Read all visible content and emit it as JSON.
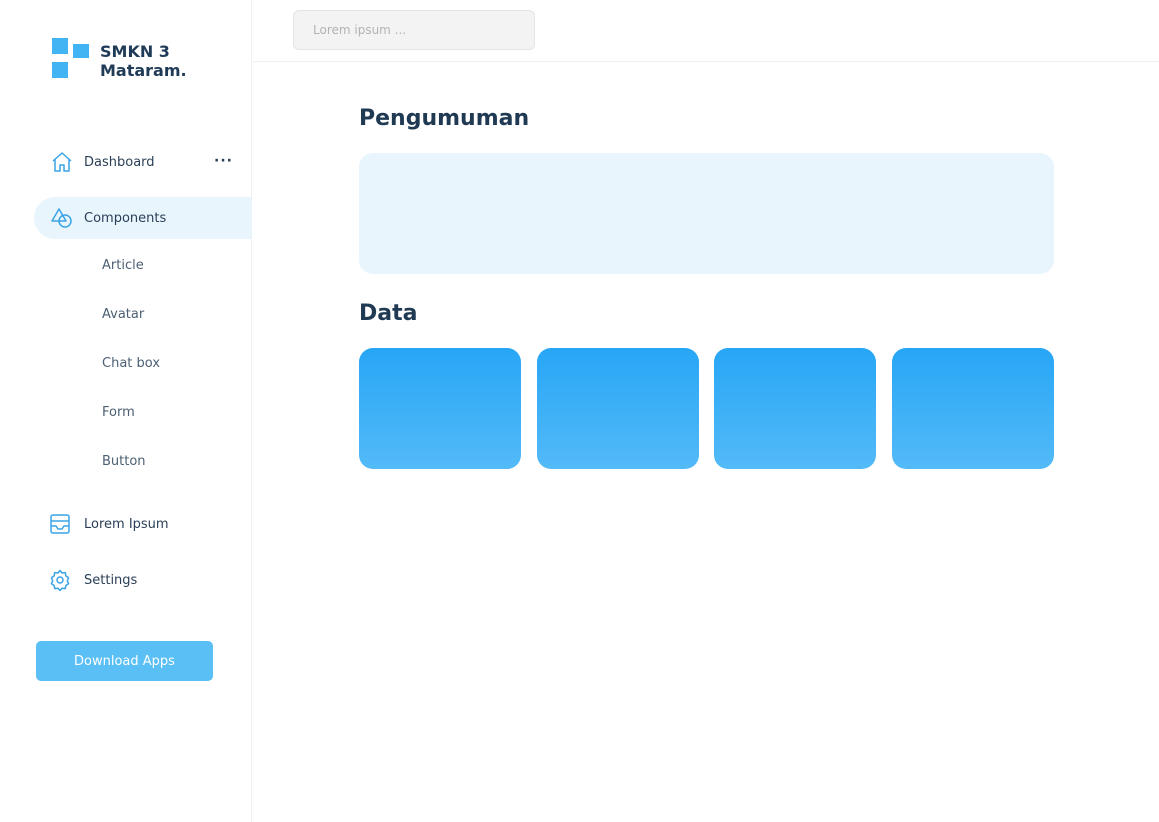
{
  "brand": {
    "name": "SMKN 3\nMataram."
  },
  "search": {
    "placeholder": "Lorem ipsum ..."
  },
  "sidebar": {
    "items": [
      {
        "label": "Dashboard",
        "icon": "home-icon"
      },
      {
        "label": "Components",
        "icon": "shapes-icon"
      },
      {
        "label": "Lorem Ipsum",
        "icon": "inbox-icon"
      },
      {
        "label": "Settings",
        "icon": "gear-icon"
      }
    ],
    "more": "···",
    "sub_items": [
      "Article",
      "Avatar",
      "Chat box",
      "Form",
      "Button"
    ],
    "download_label": "Download Apps"
  },
  "main": {
    "announcement_title": "Pengumuman",
    "data_title": "Data"
  },
  "colors": {
    "accent": "#42b4f4",
    "active_bg": "#e8f5fd",
    "card_top": "#27a6f6",
    "card_bottom": "#53baf7"
  }
}
